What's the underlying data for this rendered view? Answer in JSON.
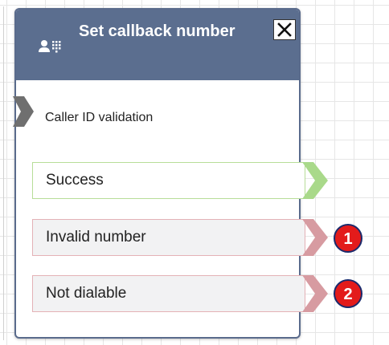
{
  "block": {
    "title": "Set callback number",
    "icon": "person-keypad-icon",
    "close_icon": "close-icon",
    "input_label": "Caller ID validation"
  },
  "branches": [
    {
      "label": "Success",
      "type": "success"
    },
    {
      "label": "Invalid number",
      "type": "error",
      "badge": "1"
    },
    {
      "label": "Not dialable",
      "type": "error",
      "badge": "2"
    }
  ],
  "colors": {
    "header": "#5b6e8f",
    "border": "#5a6b8c",
    "success": "#b7dd98",
    "error": "#e4b2b6",
    "badge": "#e31b1b"
  }
}
